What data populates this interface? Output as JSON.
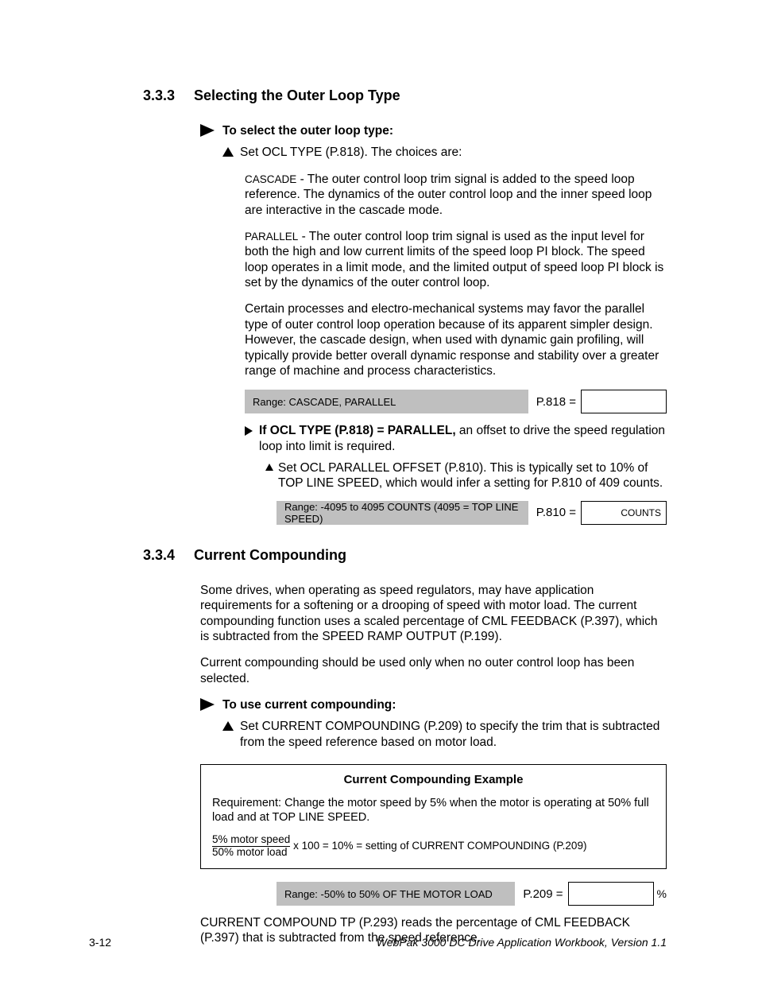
{
  "sections": {
    "s333_num": "3.3.3",
    "s333_title": "Selecting the Outer Loop Type",
    "s333_to_select": "To select the outer loop type:",
    "s333_set_ocl": "Set OCL TYPE (P.818). The choices are:",
    "s333_cascade_lead": "CASCADE",
    "s333_cascade_body": " - The outer control loop trim signal is added to the speed loop reference. The dynamics of the outer control loop and the inner speed loop are interactive in the cascade mode.",
    "s333_parallel_lead": "PARALLEL",
    "s333_parallel_body": " - The outer control loop trim signal is used as the input level for both the high and low current limits of the speed loop PI block. The speed loop operates in a limit mode, and the limited output of speed loop PI block is set by the dynamics of the outer control loop.",
    "s333_note": "Certain processes and electro-mechanical systems may favor the parallel type of outer control loop operation because of its apparent simpler design. However, the cascade design, when used with dynamic gain profiling, will typically provide better overall dynamic response and stability over a greater range of machine and process characteristics.",
    "s333_range1": "Range: CASCADE, PARALLEL",
    "s333_plabel1": "P.818 =",
    "s333_pbox1": "",
    "s333_if_parallel_lead": "If OCL TYPE (P.818) = PARALLEL,",
    "s333_if_parallel_body": " an offset to drive the speed regulation loop into limit is required.",
    "s333_set_offset": "Set OCL PARALLEL OFFSET (P.810). This is typically set to 10% of TOP LINE SPEED, which would infer a setting for P.810 of 409 counts.",
    "s333_range2": "Range: -4095 to 4095 COUNTS (4095 = TOP LINE SPEED)",
    "s333_plabel2": "P.810 =",
    "s333_pbox2": "COUNTS",
    "s334_num": "3.3.4",
    "s334_title": "Current Compounding",
    "s334_p1": "Some drives, when operating as speed regulators, may have application requirements for a softening or a drooping of speed with motor load. The current compounding function uses a scaled percentage of CML FEEDBACK (P.397), which is subtracted from the SPEED RAMP OUTPUT (P.199).",
    "s334_p2": "Current compounding should be used only when no outer control loop has been selected.",
    "s334_to_use": "To use current compounding:",
    "s334_set_cc": "Set CURRENT COMPOUNDING (P.209) to specify the trim that is subtracted from the speed reference based on motor load.",
    "s334_ex_title": "Current Compounding Example",
    "s334_ex_req": "Requirement: Change the motor speed by 5% when the motor is operating at 50% full load and at TOP LINE SPEED.",
    "s334_ex_frac_top": "5% motor speed",
    "s334_ex_frac_bot": "50% motor load",
    "s334_ex_tail": " x 100 = 10% = setting of CURRENT COMPOUNDING (P.209)",
    "s334_range": "Range: -50% to 50% OF THE MOTOR LOAD",
    "s334_plabel": "P.209 =",
    "s334_pbox_suffix": "%",
    "s334_p3": "CURRENT COMPOUND TP (P.293) reads the percentage of CML FEEDBACK (P.397) that is subtracted from the speed reference."
  },
  "footer": {
    "page": "3-12",
    "doc": "WebPak 3000 DC Drive Application Workbook, Version 1.1"
  }
}
